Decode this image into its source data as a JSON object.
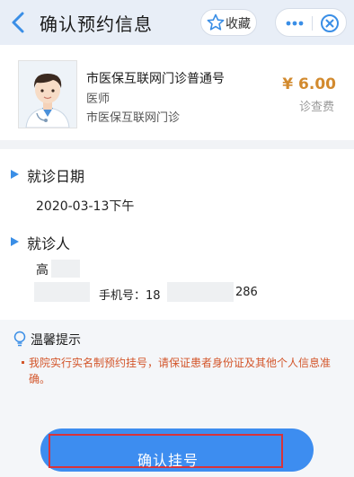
{
  "header": {
    "title": "确认预约信息",
    "favorite_label": "收藏",
    "back_icon": "chevron-left-icon",
    "more_icon": "more-dots-icon",
    "close_icon": "target-close-icon"
  },
  "doctor": {
    "service_name": "市医保互联网门诊普通号",
    "title": "医师",
    "hospital": "市医保互联网门诊",
    "price": "¥ 6.00",
    "fee_label": "诊查费"
  },
  "visit": {
    "section_title": "就诊日期",
    "date": "2020-03-13下午"
  },
  "patient": {
    "section_title": "就诊人",
    "name_visible": "高",
    "phone_label": "手机号：18",
    "phone_tail": "286"
  },
  "tips": {
    "title": "温馨提示",
    "text": "我院实行实名制预约挂号，请保证患者身份证及其他个人信息准确。"
  },
  "confirm": {
    "label": "确认挂号"
  },
  "colors": {
    "accent": "#3d8df0",
    "price": "#d28a2e",
    "warning": "#d3562b",
    "highlight_box": "#d8333a"
  }
}
